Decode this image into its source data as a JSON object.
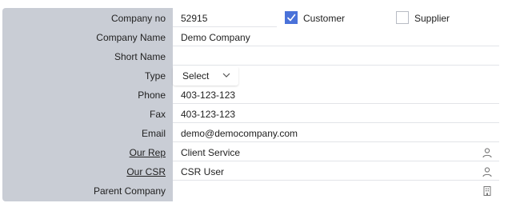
{
  "form": {
    "company_no": {
      "label": "Company no",
      "value": "52915"
    },
    "customer": {
      "label": "Customer",
      "checked": true
    },
    "supplier": {
      "label": "Supplier",
      "checked": false
    },
    "company_name": {
      "label": "Company Name",
      "value": "Demo Company"
    },
    "short_name": {
      "label": "Short Name",
      "value": ""
    },
    "type": {
      "label": "Type",
      "value": "Select"
    },
    "phone": {
      "label": "Phone",
      "value": "403-123-123"
    },
    "fax": {
      "label": "Fax",
      "value": "403-123-123"
    },
    "email": {
      "label": "Email",
      "value": "demo@democompany.com"
    },
    "our_rep": {
      "label": "Our Rep",
      "value": "Client Service",
      "icon": "person-icon"
    },
    "our_csr": {
      "label": "Our CSR",
      "value": "CSR User",
      "icon": "person-icon"
    },
    "parent_company": {
      "label": "Parent Company",
      "value": "",
      "icon": "building-icon"
    }
  },
  "colors": {
    "panel_bg": "#c9cdd5",
    "checkbox_checked": "#4a72d9"
  }
}
